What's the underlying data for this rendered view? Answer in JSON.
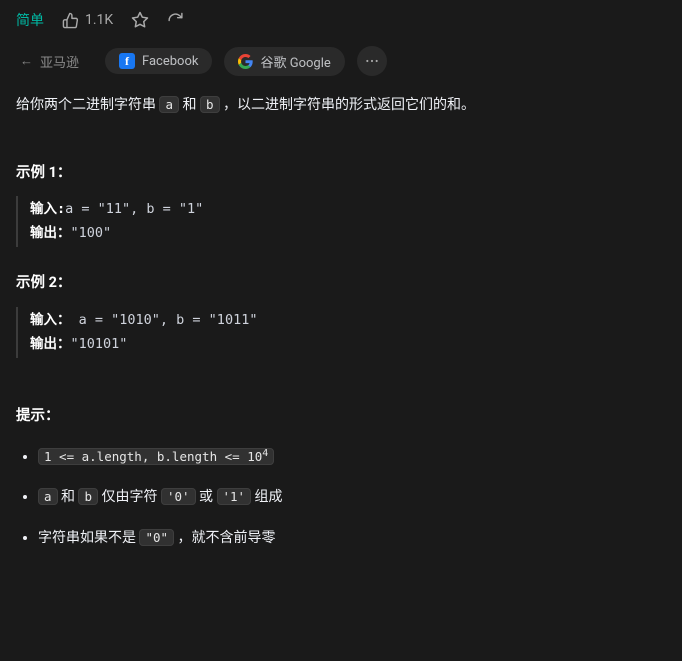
{
  "header": {
    "difficulty": "简单",
    "like_count": "1.1K"
  },
  "tags": {
    "arrow": "←",
    "amazon": "亚马逊",
    "facebook": "Facebook",
    "google": "谷歌 Google"
  },
  "desc": {
    "pre1": "给你两个二进制字符串 ",
    "a": "a",
    "mid1": " 和 ",
    "b": "b",
    "post1": " ，以二进制字符串的形式返回它们的和。"
  },
  "example1": {
    "title": "示例 1：",
    "in_lbl": "输入:",
    "in_val": "a = \"11\", b = \"1\"",
    "out_lbl": "输出：",
    "out_val": "\"100\""
  },
  "example2": {
    "title": "示例 2：",
    "in_lbl": "输入：",
    "in_val": "a = \"1010\", b = \"1011\"",
    "out_lbl": "输出：",
    "out_val": "\"10101\""
  },
  "hints": {
    "title": "提示：",
    "c1_pre": "1 <= a.length, b.length <= 10",
    "c1_sup": "4",
    "c2_a": "a",
    "c2_mid1": " 和 ",
    "c2_b": "b",
    "c2_mid2": " 仅由字符 ",
    "c2_zero": "'0'",
    "c2_or": " 或 ",
    "c2_one": "'1'",
    "c2_end": " 组成",
    "c3_pre": "字符串如果不是 ",
    "c3_zero": "\"0\"",
    "c3_post": " ，就不含前导零"
  }
}
